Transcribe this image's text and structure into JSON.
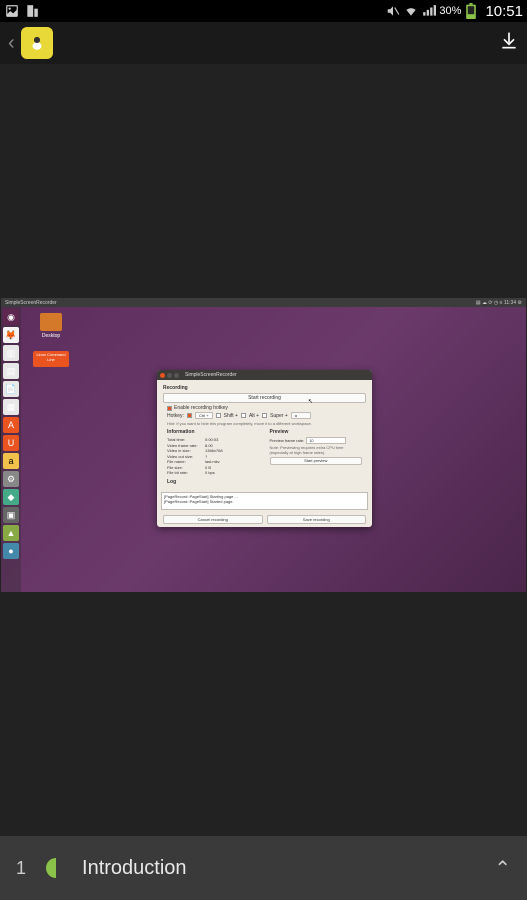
{
  "status_bar": {
    "battery_pct": "30%",
    "clock": "10:51"
  },
  "ubuntu": {
    "top_title": "SimpleScreenRecorder",
    "top_time": "11:34",
    "desktop_folder": "Desktop",
    "cmd_line": "Linux Command Line"
  },
  "dialog": {
    "title": "SimpleScreenRecorder",
    "recording_heading": "Recording",
    "start_btn": "Start recording",
    "enable_hotkey": "Enable recording hotkey",
    "hotkey_label": "Hotkey:",
    "ctrl": "Ctrl +",
    "shift": "Shift +",
    "alt": "Alt +",
    "super": "Super +",
    "keyval": "a",
    "hint": "Hint: If you want to hide this program completely, move it to a different workspace.",
    "info_heading": "Information",
    "preview_heading": "Preview",
    "total_time_l": "Total time:",
    "total_time_v": "0:00:03",
    "vfr_l": "Video frame rate:",
    "vfr_v": "8.00",
    "vis_l": "Video in size:",
    "vis_v": "1366x768",
    "vos_l": "Video out size:",
    "vos_v": "?",
    "fn_l": "File name:",
    "fn_v": "last.mkv",
    "fs_l": "File size:",
    "fs_v": "0 B",
    "fbr_l": "File bit rate:",
    "fbr_v": "0 bps",
    "pfr_l": "Preview frame rate:",
    "pfr_v": "10",
    "note": "Note: Previewing requires extra CPU time (especially at high frame rates).",
    "start_preview": "Start preview",
    "log_heading": "Log",
    "log_1": "[PageRecord::PageStart] Starting page ...",
    "log_2": "[PageRecord::PageStart] Started page.",
    "cancel": "Cancel recording",
    "save": "Save recording"
  },
  "bottom_nav": {
    "number": "1",
    "title": "Introduction"
  }
}
